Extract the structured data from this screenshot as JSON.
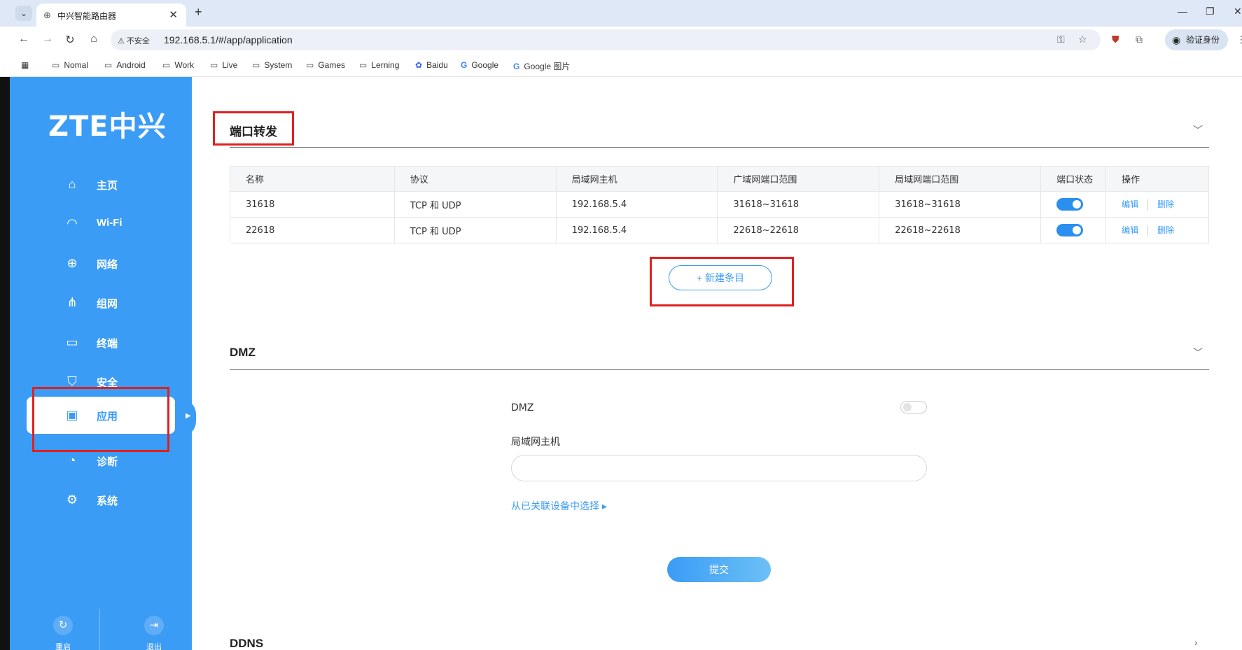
{
  "browser": {
    "tab_title": "中兴智能路由器",
    "close_glyph": "✕",
    "newtab_glyph": "+",
    "security_label": "不安全",
    "url": "192.168.5.1/#/app/application",
    "profile_label": "验证身份",
    "bookmarks": [
      "Nomal",
      "Android",
      "Work",
      "Live",
      "System",
      "Games",
      "Lerning",
      "Baidu",
      "Google",
      "Google 图片"
    ]
  },
  "sidebar": {
    "logo": "ZTE中兴",
    "items": [
      {
        "label": "主页",
        "icon": "home-icon"
      },
      {
        "label": "Wi-Fi",
        "icon": "wifi-icon"
      },
      {
        "label": "网络",
        "icon": "globe-icon"
      },
      {
        "label": "组网",
        "icon": "mesh-icon"
      },
      {
        "label": "终端",
        "icon": "devices-icon"
      },
      {
        "label": "安全",
        "icon": "shield-icon"
      },
      {
        "label": "应用",
        "icon": "apps-icon",
        "active": true
      },
      {
        "label": "诊断",
        "icon": "diagnose-icon"
      },
      {
        "label": "系统",
        "icon": "settings-icon"
      }
    ],
    "restart_label": "重启",
    "logout_label": "退出"
  },
  "port_forward": {
    "title": "端口转发",
    "columns": [
      "名称",
      "协议",
      "局域网主机",
      "广域网端口范围",
      "局域网端口范围",
      "端口状态",
      "操作"
    ],
    "rows": [
      {
        "name": "31618",
        "protocol": "TCP 和 UDP",
        "lan_host": "192.168.5.4",
        "wan_range": "31618~31618",
        "lan_range": "31618~31618",
        "enabled": true
      },
      {
        "name": "22618",
        "protocol": "TCP 和 UDP",
        "lan_host": "192.168.5.4",
        "wan_range": "22618~22618",
        "lan_range": "22618~22618",
        "enabled": true
      }
    ],
    "edit_label": "编辑",
    "delete_label": "删除",
    "new_button": "+ 新建条目"
  },
  "dmz": {
    "title": "DMZ",
    "toggle_label": "DMZ",
    "enabled": false,
    "lan_host_label": "局域网主机",
    "lan_host_value": "",
    "select_link": "从已关联设备中选择 ▸",
    "submit": "提交"
  },
  "ddns": {
    "title": "DDNS"
  },
  "colors": {
    "sidebar": "#3b9cf5",
    "accent": "#2b8ff0",
    "highlight_box": "#e02020"
  }
}
